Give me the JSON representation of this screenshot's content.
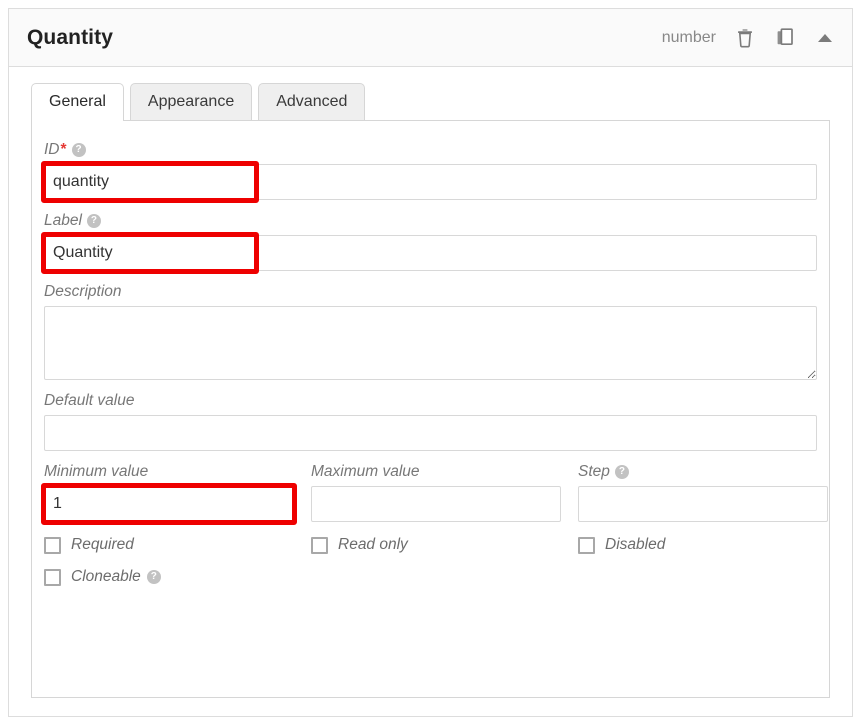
{
  "panel": {
    "title": "Quantity",
    "field_type": "number",
    "header_icons": [
      {
        "name": "delete-icon",
        "title": "Delete"
      },
      {
        "name": "duplicate-icon",
        "title": "Duplicate"
      },
      {
        "name": "collapse-icon",
        "title": "Collapse"
      }
    ]
  },
  "tabs": [
    {
      "label": "General",
      "active": true
    },
    {
      "label": "Appearance",
      "active": false
    },
    {
      "label": "Advanced",
      "active": false
    }
  ],
  "fields": {
    "id": {
      "label": "ID",
      "required_marker": "*",
      "help": "?",
      "value": "quantity",
      "placeholder": "",
      "highlighted": true
    },
    "label": {
      "label": "Label",
      "help": "?",
      "value": "Quantity",
      "placeholder": "",
      "highlighted": true
    },
    "description": {
      "label": "Description",
      "value": "",
      "placeholder": ""
    },
    "default_value": {
      "label": "Default value",
      "value": "",
      "placeholder": ""
    },
    "minimum_value": {
      "label": "Minimum value",
      "value": "1",
      "placeholder": "",
      "highlighted": true
    },
    "maximum_value": {
      "label": "Maximum value",
      "value": "",
      "placeholder": ""
    },
    "step": {
      "label": "Step",
      "help": "?",
      "value": "",
      "placeholder": ""
    }
  },
  "checkboxes": {
    "required": {
      "label": "Required",
      "checked": false
    },
    "read_only": {
      "label": "Read only",
      "checked": false
    },
    "disabled": {
      "label": "Disabled",
      "checked": false
    },
    "cloneable": {
      "label": "Cloneable",
      "checked": false,
      "help": "?"
    }
  },
  "colors": {
    "annotation": "#ee0000",
    "required_star": "#e53935",
    "header_bg": "#fafafa",
    "border": "#dddddd",
    "tab_inactive_bg": "#efefef"
  }
}
